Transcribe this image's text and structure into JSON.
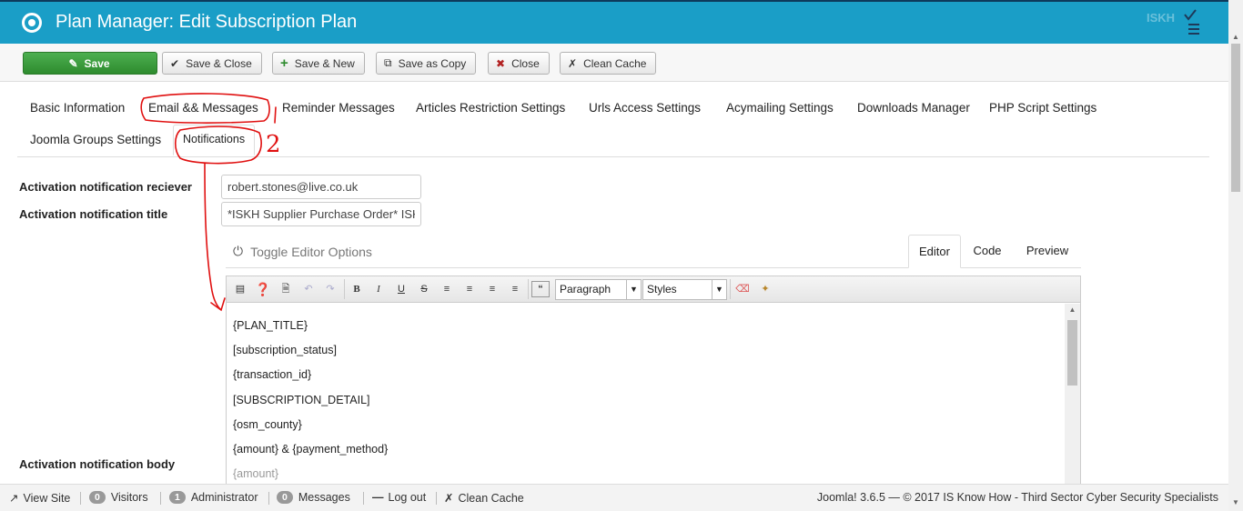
{
  "header": {
    "title": "Plan Manager: Edit Subscription Plan",
    "brand_text": "ISKH"
  },
  "toolbar": {
    "save": "Save",
    "save_close": "Save & Close",
    "save_new": "Save & New",
    "save_copy": "Save as Copy",
    "close": "Close",
    "clean_cache": "Clean Cache"
  },
  "tabs": {
    "basic": "Basic Information",
    "email": "Email && Messages",
    "reminder": "Reminder Messages",
    "articles": "Articles Restriction Settings",
    "urls": "Urls Access Settings",
    "acymailing": "Acymailing Settings",
    "downloads": "Downloads Manager",
    "php": "PHP Script Settings",
    "joomla_groups": "Joomla Groups Settings",
    "notifications": "Notifications"
  },
  "form": {
    "receiver_label": "Activation notification reciever",
    "receiver_value": "robert.stones@live.co.uk",
    "title_label": "Activation notification title",
    "title_value": "*ISKH Supplier Purchase Order* ISKH",
    "body_label": "Activation notification body"
  },
  "editor": {
    "toggle": "Toggle Editor Options",
    "tab_editor": "Editor",
    "tab_code": "Code",
    "tab_preview": "Preview",
    "format_select": "Paragraph",
    "styles_select": "Styles",
    "lines": [
      "{PLAN_TITLE}",
      "[subscription_status]",
      "{transaction_id}",
      "[SUBSCRIPTION_DETAIL]",
      "{osm_county}",
      "{amount} & {payment_method}",
      "{amount}"
    ]
  },
  "statusbar": {
    "view_site": "View Site",
    "visitors_count": "0",
    "visitors": "Visitors",
    "admin_count": "1",
    "administrator": "Administrator",
    "messages_count": "0",
    "messages": "Messages",
    "logout": "Log out",
    "clean_cache": "Clean Cache",
    "footer": "Joomla! 3.6.5  —  © 2017 IS Know How - Third Sector Cyber Security Specialists"
  },
  "annotations": {
    "mark1": "1",
    "mark2": "2"
  },
  "colors": {
    "header_bg": "#1a9ec7",
    "save_bg": "#2e8b2e",
    "annotation": "#e01010"
  }
}
